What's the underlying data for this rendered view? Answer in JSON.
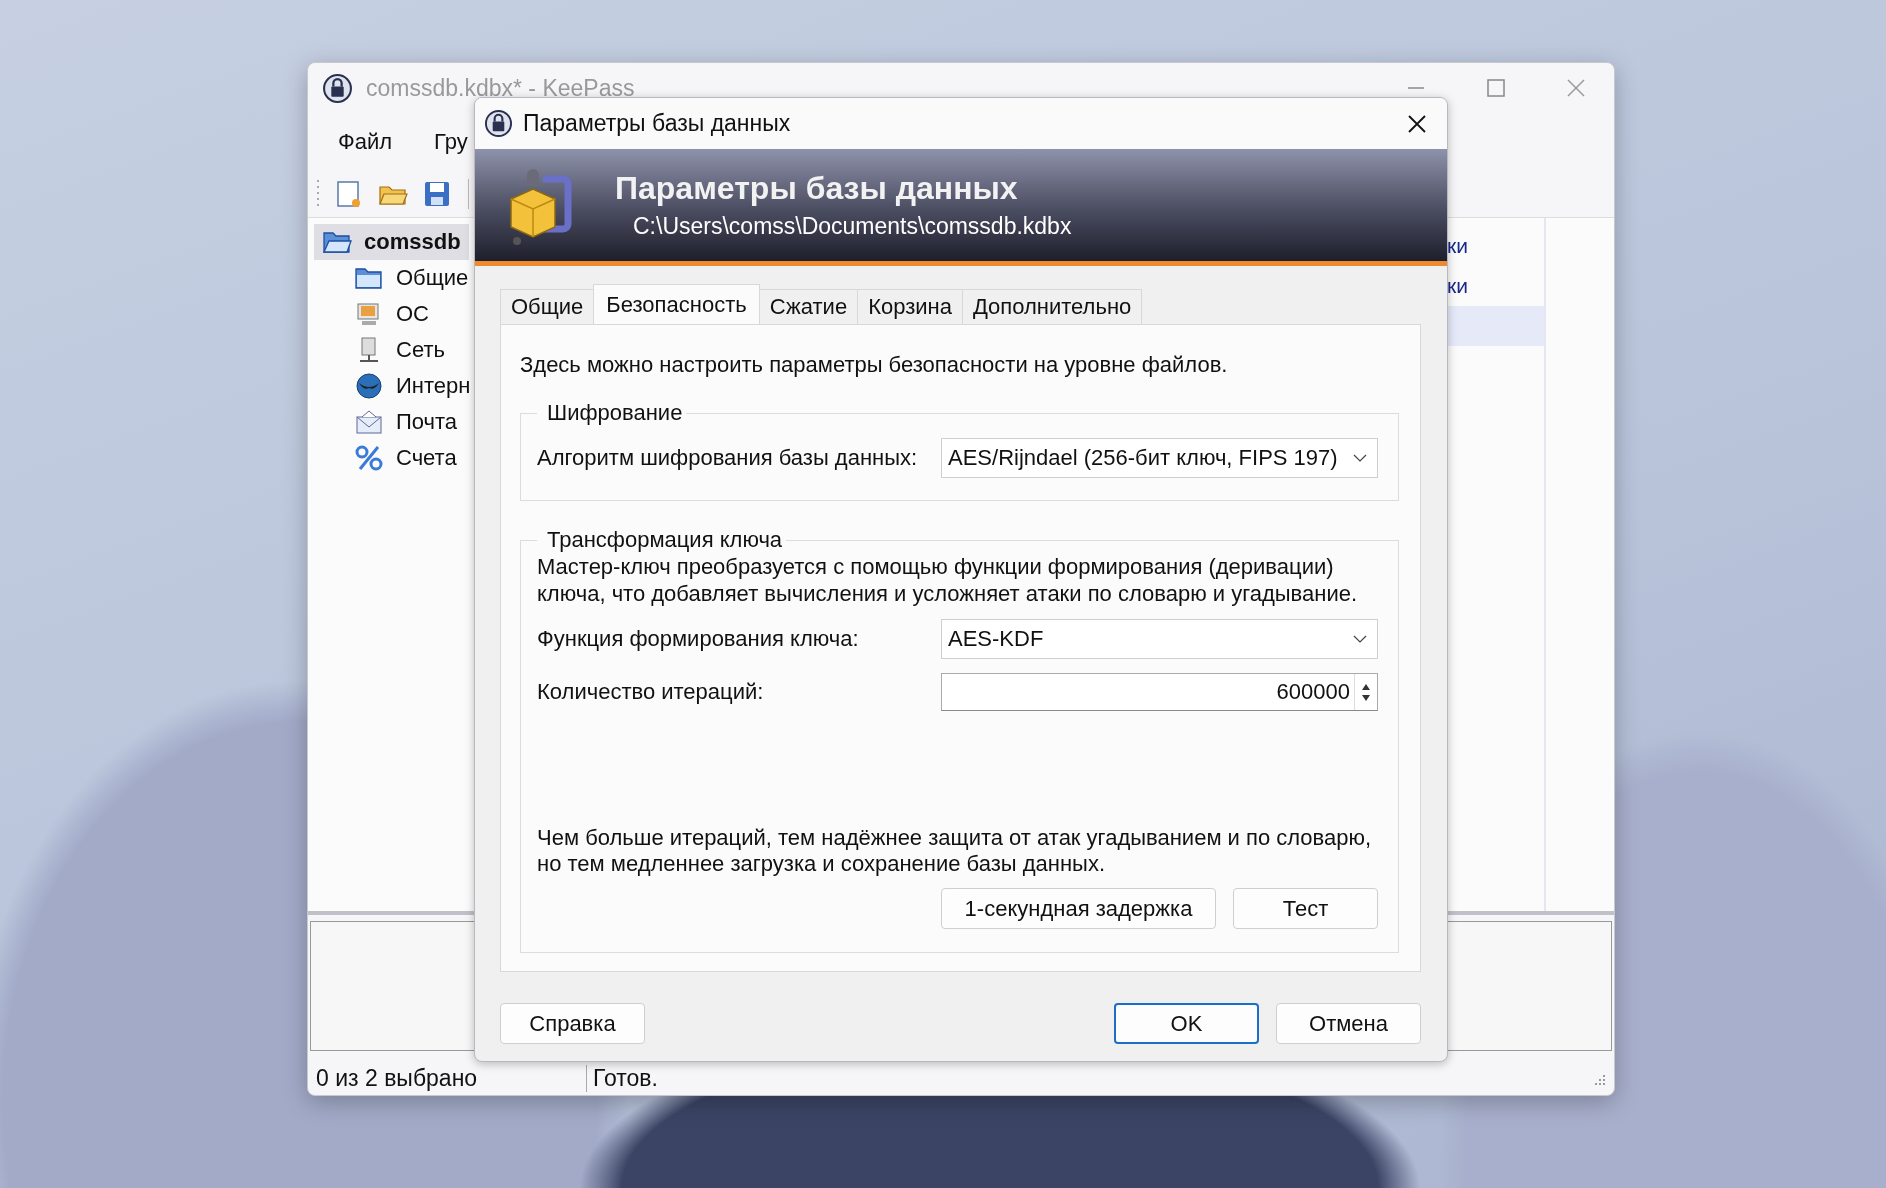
{
  "main_window": {
    "title": "comssdb.kdbx* - KeePass",
    "menu": [
      "Файл",
      "Гру"
    ],
    "tree": {
      "label": "comssdb",
      "selected": true,
      "children": [
        {
          "label": "Общие"
        },
        {
          "label": "ОС"
        },
        {
          "label": "Сеть"
        },
        {
          "label": "Интерн"
        },
        {
          "label": "Почта"
        },
        {
          "label": "Счета"
        }
      ]
    },
    "entry_list": {
      "rows": [
        {
          "column_1": "ки",
          "selected": false
        },
        {
          "column_1": "ки",
          "selected": false
        },
        {
          "selected": true
        }
      ]
    },
    "status_bar": [
      "0 из 2 выбрано",
      "Готов."
    ]
  },
  "dialog": {
    "title": "Параметры базы данных",
    "header": {
      "title": "Параметры базы данных",
      "path": "C:\\Users\\comss\\Documents\\comssdb.kdbx"
    },
    "tabs": [
      {
        "label": "Общие",
        "selected": false
      },
      {
        "label": "Безопасность",
        "selected": true
      },
      {
        "label": "Сжатие",
        "selected": false
      },
      {
        "label": "Корзина",
        "selected": false
      },
      {
        "label": "Дополнительно",
        "selected": false
      }
    ],
    "description": "Здесь можно настроить параметры безопасности на уровне файлов.",
    "encryption": {
      "title": "Шифрование",
      "algorithm_label": "Алгоритм шифрования базы данных:",
      "algorithm_value": "AES/Rijndael (256-бит ключ, FIPS 197)"
    },
    "key_transformation": {
      "title": "Трансформация ключа",
      "description": "Мастер-ключ преобразуется с помощью функции формирования (деривации) ключа, что добавляет вычисления и усложняет атаки по словарю и угадывание.",
      "kdf_label": "Функция формирования ключа:",
      "kdf_value": "AES-KDF",
      "iterations_label": "Количество итераций:",
      "iterations_value": "600000",
      "note": "Чем больше итераций, тем надёжнее защита от атак угадыванием и по словарю, но тем медленнее загрузка и сохранение базы данных.",
      "buttons": [
        "1-секундная задержка",
        "Тест"
      ]
    },
    "buttons": [
      {
        "label": "Справка",
        "default": false
      },
      {
        "label": "OK",
        "default": true
      },
      {
        "label": "Отмена",
        "default": false
      }
    ]
  }
}
